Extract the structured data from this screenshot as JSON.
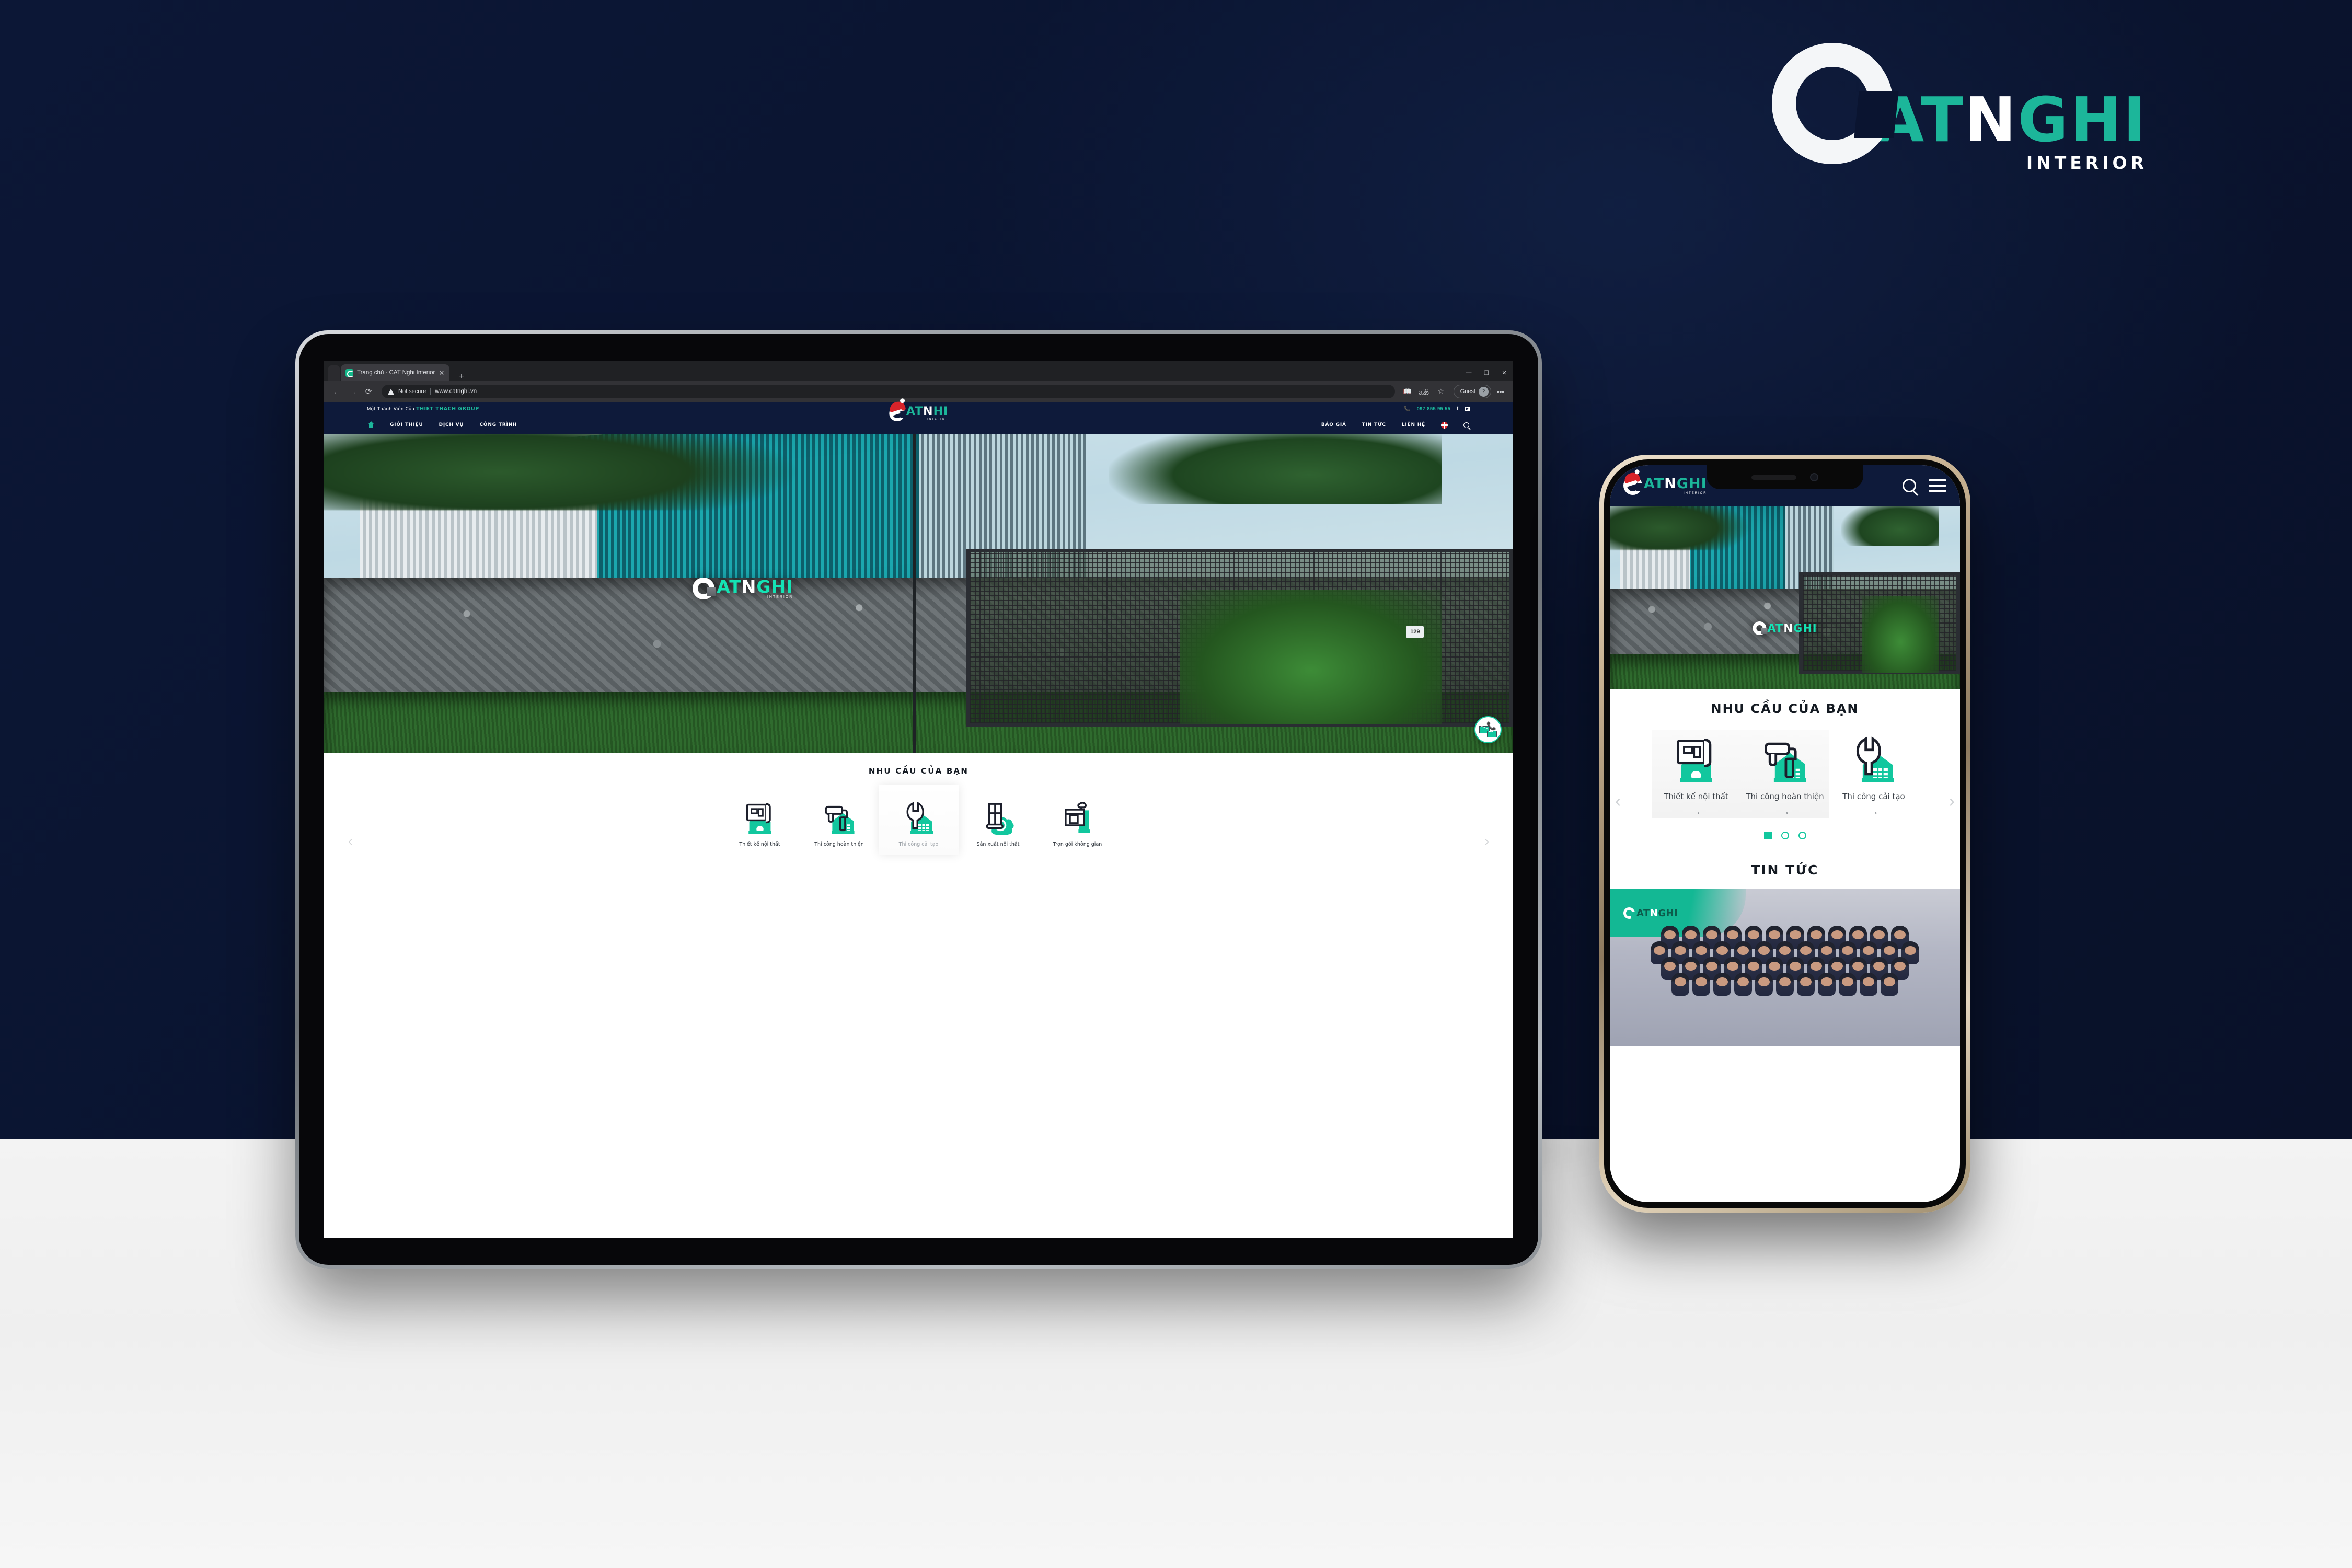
{
  "brand": {
    "logo_c": "C",
    "logo_at": "AT",
    "logo_n": "N",
    "logo_ghi": "GHI",
    "logo_sub": "INTERIOR",
    "accent_teal": "#1cb69a",
    "accent_bright": "#14e3b4",
    "navy": "#0e1a3a",
    "background_navy": "#0a1430",
    "background_light": "#f2f2f2"
  },
  "tablet": {
    "browser": {
      "tab": {
        "title": "Trang chủ - CAT Nghi Interior",
        "close": "✕",
        "new_tab": "+"
      },
      "window_controls": {
        "minimize": "—",
        "maximize": "❐",
        "close": "✕"
      },
      "nav": {
        "back": "←",
        "forward": "→",
        "reload": "⟳"
      },
      "omnibox": {
        "security": "Not secure",
        "url": "www.catnghi.vn"
      },
      "toolbar": {
        "read_aloud": "read-aloud",
        "translate": "aあ",
        "favorites": "☆",
        "profile_label": "Guest",
        "profile_avatar": "?",
        "more": "•••"
      }
    },
    "site": {
      "topbar": {
        "member_prefix": "Một Thành Viên Của",
        "member_group": "THIET THACH GROUP",
        "phone": "097 855 95 55",
        "facebook": "f",
        "youtube": "▶"
      },
      "nav_left": [
        "GIỚI THIỆU",
        "DỊCH VỤ",
        "CÔNG TRÌNH"
      ],
      "nav_right": [
        "BÁO GIÁ",
        "TIN TỨC",
        "LIÊN HỆ"
      ],
      "logo": {
        "c": "C",
        "at": "AT",
        "n": "N",
        "ghi": "HI",
        "sub": "INTERIOR"
      },
      "hero": {
        "watermark": {
          "c": "C",
          "at": "AT",
          "n": "N",
          "ghi": "GHI",
          "sub": "INTERIOR"
        },
        "house_number": "129"
      },
      "needs": {
        "title": "NHU CẦU CỦA BẠN",
        "prev_arrow": "‹",
        "next_arrow": "›",
        "items": [
          {
            "label": "Thiết kế nội thất",
            "icon": "blueprint-house-icon",
            "active": false
          },
          {
            "label": "Thi công hoàn thiện",
            "icon": "paint-roller-house-icon",
            "active": false
          },
          {
            "label": "Thi công cải tạo",
            "icon": "wrench-house-icon",
            "active": true
          },
          {
            "label": "Sản xuất nội thất",
            "icon": "window-saw-icon",
            "active": false
          },
          {
            "label": "Trọn gói không gian",
            "icon": "furniture-package-icon",
            "active": false
          }
        ]
      },
      "fab": {
        "name": "contact-float-button"
      }
    }
  },
  "phone": {
    "header": {
      "search": "search-icon",
      "menu": "hamburger-icon"
    },
    "logo": {
      "c": "C",
      "at": "AT",
      "n": "N",
      "ghi": "GHI",
      "sub": "INTERIOR"
    },
    "hero_watermark": {
      "c": "C",
      "at": "AT",
      "n": "N",
      "ghi": "GHI"
    },
    "needs": {
      "title": "NHU CẦU CỦA BẠN",
      "prev_arrow": "‹",
      "next_arrow": "›",
      "link_arrow": "→",
      "items": [
        {
          "label": "Thiết kế nội thất",
          "icon": "blueprint-house-icon"
        },
        {
          "label": "Thi công hoàn thiện",
          "icon": "paint-roller-house-icon"
        },
        {
          "label": "Thi công cải tạo",
          "icon": "wrench-house-icon"
        }
      ],
      "dots": [
        true,
        false,
        false
      ]
    },
    "news": {
      "title": "TIN TỨC",
      "corner_logo": {
        "c": "C",
        "at": "AT",
        "n": "N",
        "ghi": "GHI"
      }
    }
  }
}
